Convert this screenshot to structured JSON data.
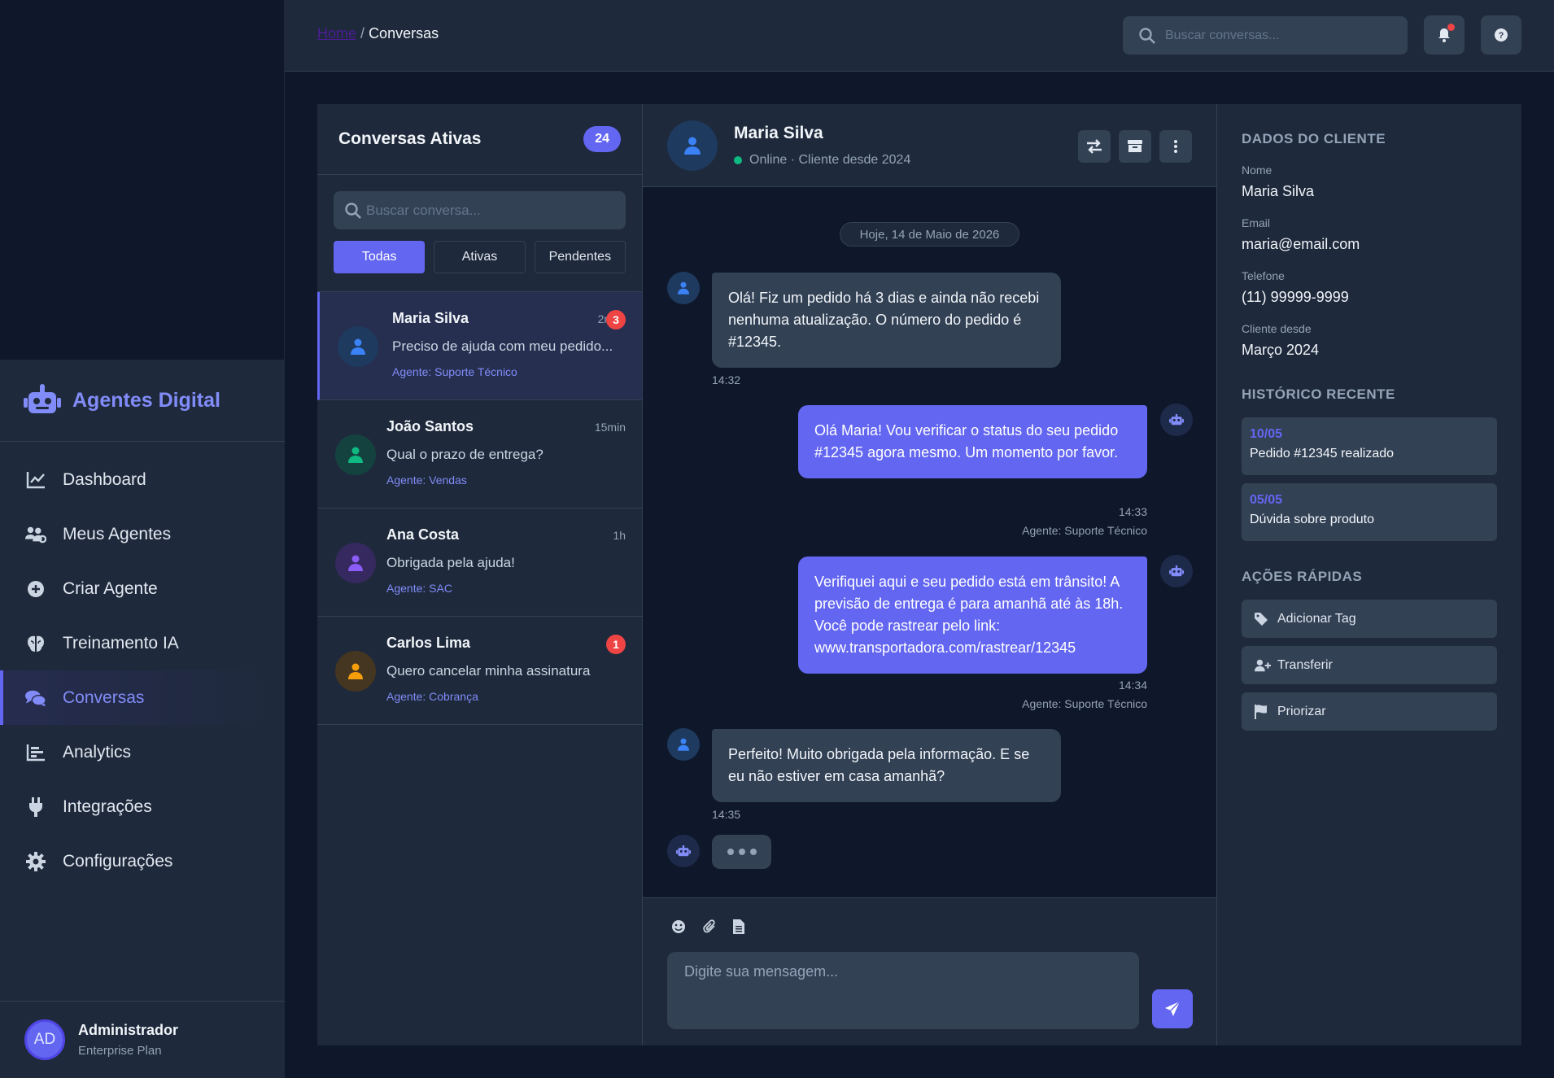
{
  "brand": {
    "name": "Agentes Digital"
  },
  "nav": [
    {
      "label": "Dashboard",
      "icon": "chart-line-icon"
    },
    {
      "label": "Meus Agentes",
      "icon": "users-gear-icon"
    },
    {
      "label": "Criar Agente",
      "icon": "plus-circle-icon"
    },
    {
      "label": "Treinamento IA",
      "icon": "brain-icon"
    },
    {
      "label": "Conversas",
      "icon": "comments-icon",
      "active": true
    },
    {
      "label": "Analytics",
      "icon": "chart-bar-icon"
    },
    {
      "label": "Integrações",
      "icon": "plug-icon"
    },
    {
      "label": "Configurações",
      "icon": "gear-icon"
    }
  ],
  "user": {
    "initials": "AD",
    "name": "Administrador",
    "plan": "Enterprise Plan"
  },
  "header": {
    "breadcrumb_home": "Home",
    "breadcrumb_sep": "/",
    "breadcrumb_current": "Conversas",
    "search_placeholder": "Buscar conversas..."
  },
  "conversations": {
    "title": "Conversas Ativas",
    "count": "24",
    "search_placeholder": "Buscar conversa...",
    "filters": [
      "Todas",
      "Ativas",
      "Pendentes"
    ],
    "items": [
      {
        "name": "Maria Silva",
        "time": "2min",
        "badge": "3",
        "preview": "Preciso de ajuda com meu pedido...",
        "agent": "Agente: Suporte Técnico",
        "color": "#3b82f6"
      },
      {
        "name": "João Santos",
        "time": "15min",
        "badge": "",
        "preview": "Qual o prazo de entrega?",
        "agent": "Agente: Vendas",
        "color": "#10b981"
      },
      {
        "name": "Ana Costa",
        "time": "1h",
        "badge": "",
        "preview": "Obrigada pela ajuda!",
        "agent": "Agente: SAC",
        "color": "#8b5cf6"
      },
      {
        "name": "Carlos Lima",
        "time": "",
        "badge": "1",
        "preview": "Quero cancelar minha assinatura",
        "agent": "Agente: Cobrança",
        "color": "#f59e0b"
      }
    ]
  },
  "chat": {
    "name": "Maria Silva",
    "status": "Online · Cliente desde 2024",
    "date": "Hoje, 14 de Maio de 2026",
    "messages": [
      {
        "from": "user",
        "text": "Olá! Fiz um pedido há 3 dias e ainda não recebi nenhuma atualização. O número do pedido é #12345.",
        "time": "14:32"
      },
      {
        "from": "bot",
        "text": "Olá Maria! Vou verificar o status do seu pedido #12345 agora mesmo. Um momento por favor.",
        "time": "14:33",
        "agent": "Agente: Suporte Técnico"
      },
      {
        "from": "bot",
        "text": "Verifiquei aqui e seu pedido está em trânsito! A previsão de entrega é para amanhã até às 18h. Você pode rastrear pelo link: www.transportadora.com/rastrear/12345",
        "time": "14:34",
        "agent": "Agente: Suporte Técnico"
      },
      {
        "from": "user",
        "text": "Perfeito! Muito obrigada pela informação. E se eu não estiver em casa amanhã?",
        "time": "14:35"
      }
    ],
    "input_placeholder": "Digite sua mensagem..."
  },
  "client": {
    "title": "DADOS DO CLIENTE",
    "fields": [
      {
        "label": "Nome",
        "value": "Maria Silva"
      },
      {
        "label": "Email",
        "value": "maria@email.com"
      },
      {
        "label": "Telefone",
        "value": "(11) 99999-9999"
      },
      {
        "label": "Cliente desde",
        "value": "Março 2024"
      }
    ],
    "history_title": "HISTÓRICO RECENTE",
    "history": [
      {
        "date": "10/05",
        "text": "Pedido #12345 realizado"
      },
      {
        "date": "05/05",
        "text": "Dúvida sobre produto"
      }
    ],
    "actions_title": "AÇÕES RÁPIDAS",
    "actions": [
      {
        "label": "Adicionar Tag",
        "icon": "tag-icon"
      },
      {
        "label": "Transferir",
        "icon": "user-plus-icon"
      },
      {
        "label": "Priorizar",
        "icon": "flag-icon"
      }
    ]
  },
  "colors": {
    "accent": "#6366f1",
    "accent_light": "#818cf8",
    "bg": "#0f172a",
    "panel": "#1e293b",
    "danger": "#ef4444",
    "online": "#10b981"
  }
}
